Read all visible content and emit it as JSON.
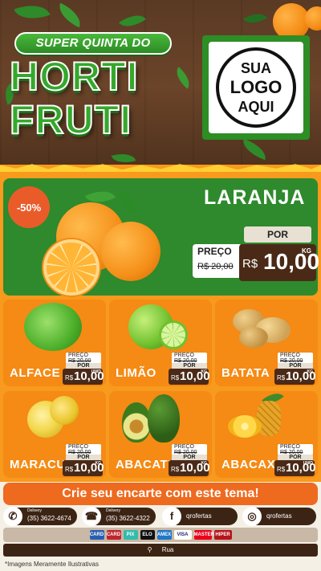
{
  "header": {
    "title_line1": "SUPER QUINTA DO",
    "title_line2": "HORTI",
    "title_line3": "FRUTI",
    "logo_lines": [
      "SUA",
      "LOGO",
      "AQUI"
    ]
  },
  "featured": {
    "discount": "-50%",
    "name": "LARANJA",
    "old_label": "PREÇO",
    "old_price": "R$ 20,00",
    "por_label": "POR",
    "currency": "R$",
    "new_price": "10,00",
    "unit": "KG",
    "icon": "orange-fruit-icon"
  },
  "products": [
    {
      "name": "ALFACE",
      "old_label": "PREÇO",
      "old_price": "R$ 20,00",
      "por_label": "POR",
      "currency": "R$",
      "price": "10,00",
      "unit": "UNID",
      "icon": "lettuce-icon"
    },
    {
      "name": "LIMÃO",
      "old_label": "PREÇO",
      "old_price": "R$ 20,00",
      "por_label": "POR",
      "currency": "R$",
      "price": "10,00",
      "unit": "KG",
      "icon": "lime-icon"
    },
    {
      "name": "BATATA",
      "old_label": "PREÇO",
      "old_price": "R$ 20,00",
      "por_label": "POR",
      "currency": "R$",
      "price": "10,00",
      "unit": "KG",
      "icon": "potato-icon"
    },
    {
      "name": "MARACUJÁ",
      "old_label": "PREÇO",
      "old_price": "R$ 20,00",
      "por_label": "POR",
      "currency": "R$",
      "price": "10,00",
      "unit": "KG",
      "icon": "passion-fruit-icon"
    },
    {
      "name": "ABACATE",
      "old_label": "PREÇO",
      "old_price": "R$ 20,00",
      "por_label": "POR",
      "currency": "R$",
      "price": "10,00",
      "unit": "KG",
      "icon": "avocado-icon"
    },
    {
      "name": "ABACAXI",
      "old_label": "PREÇO",
      "old_price": "R$ 20,00",
      "por_label": "POR",
      "currency": "R$",
      "price": "10,00",
      "unit": "UNID",
      "icon": "pineapple-icon"
    }
  ],
  "cta": "Crie seu encarte com este tema!",
  "contacts": [
    {
      "label": "Delivery",
      "value": "(35) 3622-4674",
      "icon": "whatsapp-icon"
    },
    {
      "label": "Delivery",
      "value": "(35) 3622-4322",
      "icon": "phone-icon"
    },
    {
      "value": "qrofertas",
      "icon": "facebook-icon"
    },
    {
      "value": "qrofertas",
      "icon": "instagram-icon"
    }
  ],
  "payments": [
    "CARD",
    "CARD",
    "PIX",
    "ELO",
    "AMEX",
    "VISA",
    "MASTER",
    "HIPER"
  ],
  "address": "Rua",
  "footnote": "*Imagens Meramente Ilustrativas",
  "colors": {
    "green": "#2e8a2c",
    "orange": "#f79a1d",
    "brown": "#4a2a17",
    "cta": "#ee6a1e"
  }
}
